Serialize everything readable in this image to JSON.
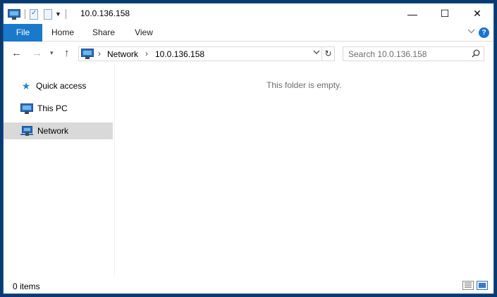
{
  "window": {
    "title": "10.0.136.158",
    "controls": {
      "minimize": "—",
      "maximize": "☐",
      "close": "✕"
    }
  },
  "ribbon": {
    "tabs": [
      {
        "label": "File",
        "active": true
      },
      {
        "label": "Home"
      },
      {
        "label": "Share"
      },
      {
        "label": "View"
      }
    ],
    "expand_icon": "chevron-down-icon",
    "help_icon": "?"
  },
  "navigation": {
    "back_icon": "←",
    "forward_icon": "→",
    "recent_icon": "▾",
    "up_icon": "↑",
    "breadcrumb": [
      "Network",
      "10.0.136.158"
    ],
    "breadcrumb_separator": "›",
    "dropdown_icon": "⌄",
    "refresh_icon": "↻",
    "search_placeholder": "Search 10.0.136.158"
  },
  "nav_pane": {
    "items": [
      {
        "label": "Quick access",
        "icon": "star-icon"
      },
      {
        "label": "This PC",
        "icon": "computer-icon"
      },
      {
        "label": "Network",
        "icon": "network-icon",
        "selected": true
      }
    ]
  },
  "content": {
    "empty_message": "This folder is empty."
  },
  "status_bar": {
    "item_count": "0 items"
  },
  "colors": {
    "file_tab": "#1979ca",
    "selection": "#d9d9d9",
    "accent": "#1c74d1"
  }
}
